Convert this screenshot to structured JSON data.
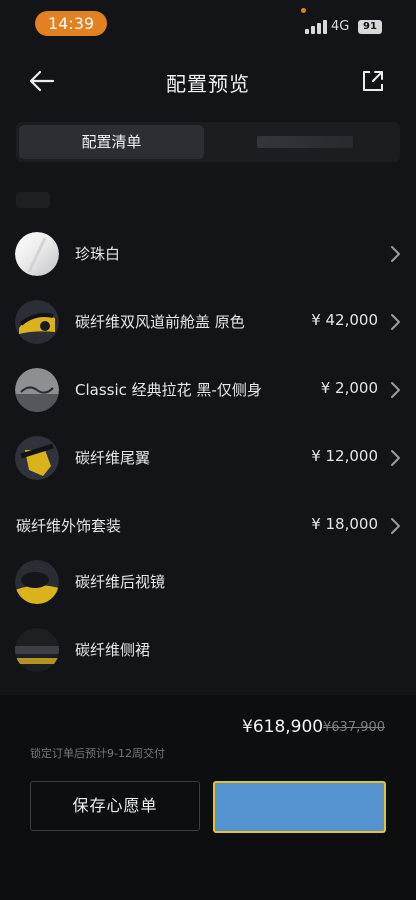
{
  "status_bar": {
    "time": "14:39",
    "network": "4G",
    "battery": "91",
    "accent_color": "#e3801f"
  },
  "header": {
    "title": "配置预览",
    "back_icon": "arrow-left-icon",
    "share_icon": "share-external-icon"
  },
  "tabs": [
    {
      "label": "配置清单",
      "active": true
    },
    {
      "label": "",
      "active": false
    }
  ],
  "options": [
    {
      "label": "珍珠白",
      "price": "",
      "swatch": "pearl-white-swatch"
    },
    {
      "label": "碳纤维双风道前舱盖 原色",
      "price": "¥ 42,000",
      "swatch": "carbon-hood-swatch"
    },
    {
      "label": "Classic 经典拉花 黑-仅侧身",
      "price": "¥ 2,000",
      "swatch": "classic-livery-swatch"
    },
    {
      "label": "碳纤维尾翼",
      "price": "¥ 12,000",
      "swatch": "carbon-wing-swatch"
    }
  ],
  "package": {
    "label": "碳纤维外饰套装",
    "price": "¥ 18,000",
    "items": [
      {
        "label": "碳纤维后视镜",
        "swatch": "carbon-mirror-swatch"
      },
      {
        "label": "碳纤维侧裙",
        "swatch": "carbon-skirt-swatch"
      }
    ]
  },
  "footer": {
    "price_now": "¥618,900",
    "price_old": "¥637,900",
    "delivery_note": "锁定订单后预计9-12周交付",
    "save_label": "保存心愿单",
    "order_color": "#5493cf",
    "order_border_color": "#e4c22a"
  }
}
